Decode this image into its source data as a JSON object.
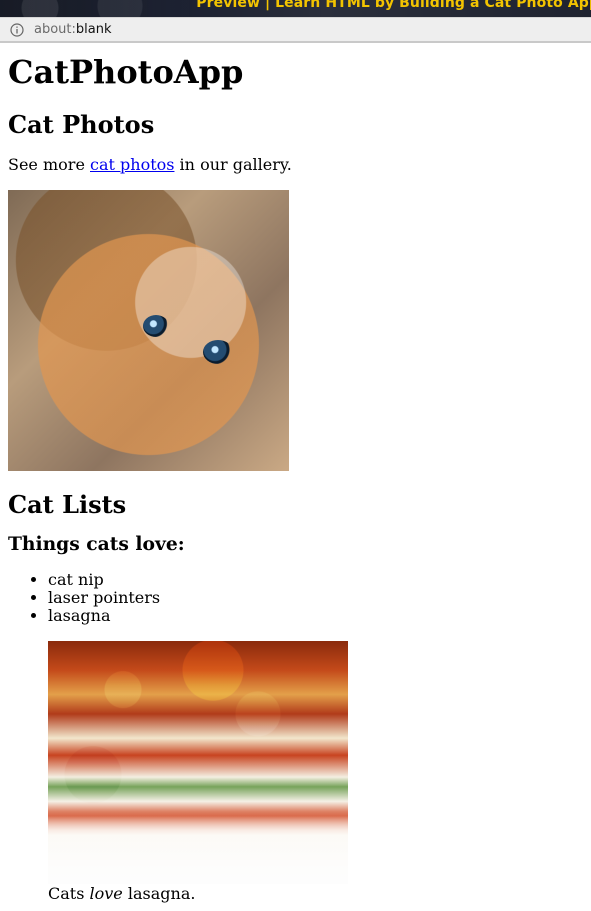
{
  "banner": {
    "title": "Preview | Learn HTML by Building a Cat Photo App"
  },
  "browser": {
    "address": {
      "scheme": "about:",
      "path": "blank"
    }
  },
  "page": {
    "h1": "CatPhotoApp",
    "section_cat_photos": {
      "h2": "Cat Photos",
      "text_before_link": "See more ",
      "link_text": "cat photos",
      "text_after_link": " in our gallery."
    },
    "section_cat_lists": {
      "h2": "Cat Lists",
      "h3": "Things cats love:",
      "items": [
        "cat nip",
        "laser pointers",
        "lasagna"
      ],
      "caption": {
        "prefix": "Cats ",
        "emphasis": "love",
        "suffix": " lasagna."
      }
    }
  },
  "icons": {
    "address_info": "info-circle-icon"
  },
  "colors": {
    "banner_text": "#f3c400",
    "link": "#0000ee",
    "addressbar_bg": "#eeeeee"
  }
}
